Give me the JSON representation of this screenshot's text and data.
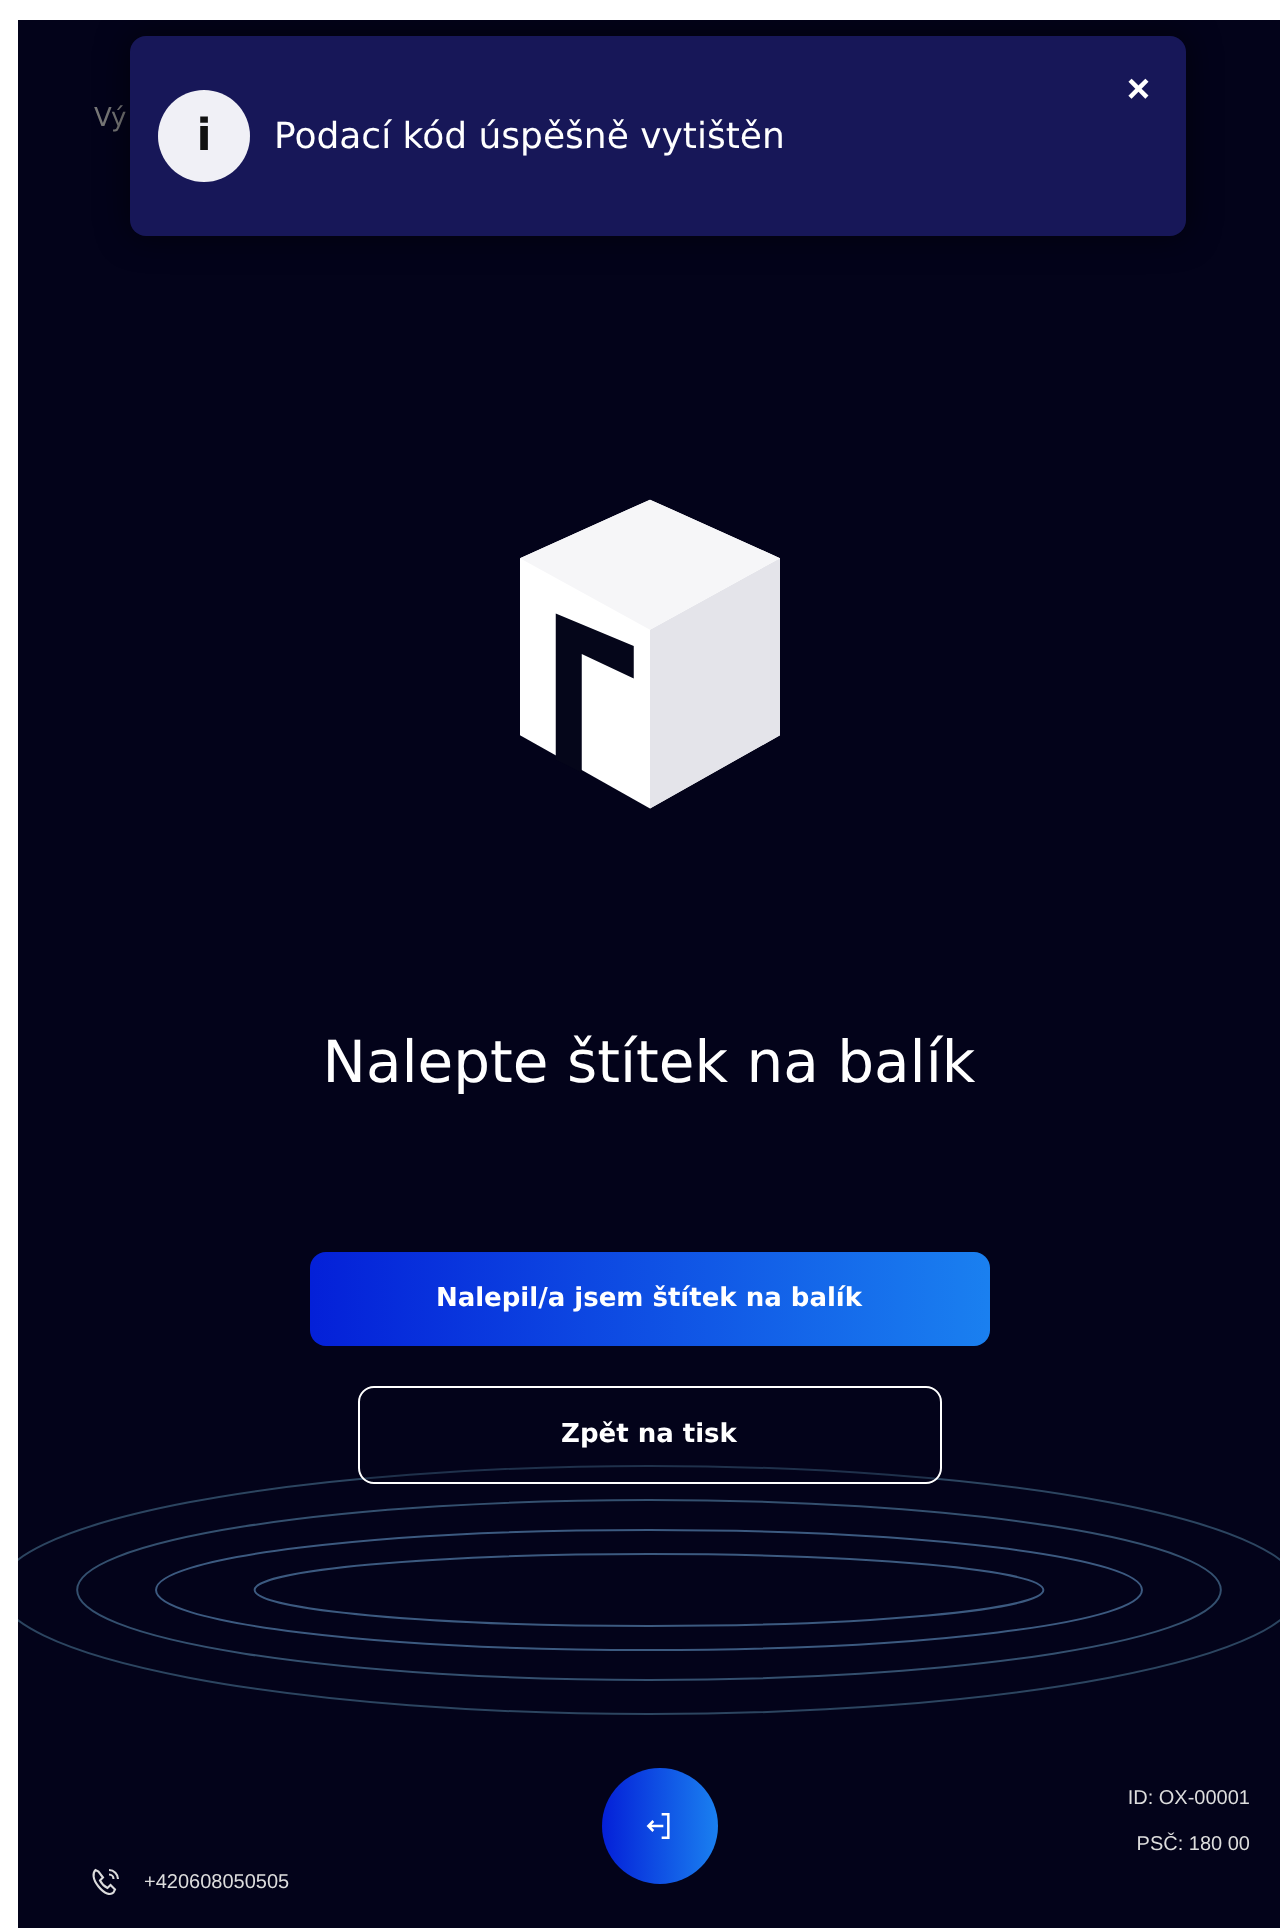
{
  "header": {
    "back_text": "Vý"
  },
  "toast": {
    "icon": "i",
    "message": "Podací kód úspěšně vytištěn",
    "close": "×"
  },
  "heading": "Nalepte štítek na balík",
  "buttons": [
    {
      "kind": "primary",
      "label": "Nalepil/a jsem štítek na balík"
    },
    {
      "kind": "outline",
      "label": "Zpět na tisk"
    }
  ],
  "footer": {
    "phone": "+420608050505",
    "id": "ID: OX-00001",
    "psc": "PSČ: 180 00"
  }
}
